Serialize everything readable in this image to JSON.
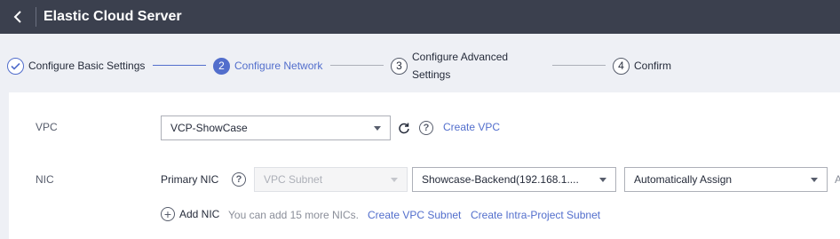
{
  "header": {
    "title": "Elastic Cloud Server",
    "back_icon": "chevron-left-icon"
  },
  "steps": [
    {
      "number": "",
      "label": "Configure Basic Settings",
      "state": "done"
    },
    {
      "number": "2",
      "label": "Configure Network",
      "state": "active"
    },
    {
      "number": "3",
      "label": "Configure Advanced Settings",
      "state": "pending"
    },
    {
      "number": "4",
      "label": "Confirm",
      "state": "pending"
    }
  ],
  "vpc": {
    "label": "VPC",
    "selected": "VCP-ShowCase",
    "create_link": "Create VPC"
  },
  "nic": {
    "label": "NIC",
    "primary_label": "Primary NIC",
    "subnet_placeholder": "VPC Subnet",
    "subnet_selected": "Showcase-Backend(192.168.1....",
    "assign_selected": "Automatically Assign",
    "add_nic": "Add NIC",
    "add_hint": "You can add 15 more NICs.",
    "create_subnet_link": "Create VPC Subnet",
    "create_intra_link": "Create Intra-Project Subnet",
    "trailing_text": "A"
  },
  "colors": {
    "accent": "#526ecc",
    "header_bg": "#3b404e"
  }
}
